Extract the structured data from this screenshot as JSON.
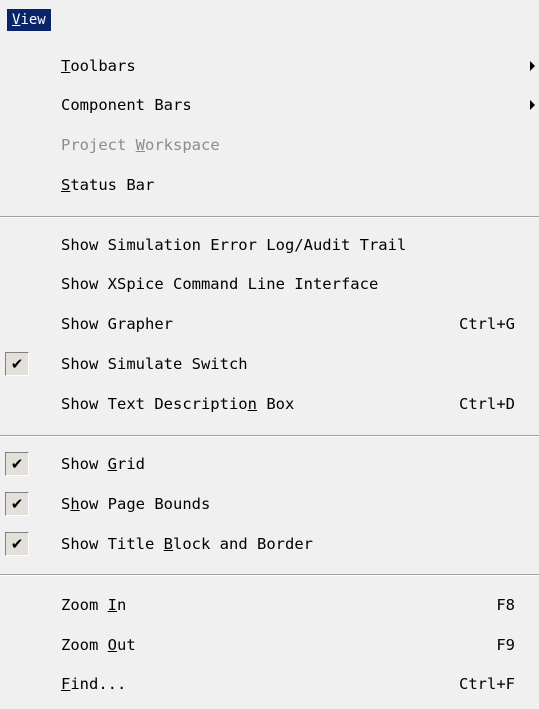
{
  "menubar": {
    "title_mnemonic": "V",
    "title_rest": "iew"
  },
  "items": {
    "toolbars": {
      "mn": "T",
      "rest": "oolbars"
    },
    "component_bars": {
      "label": "Component Bars"
    },
    "project_workspace": {
      "pre": "Project ",
      "mn": "W",
      "rest": "orkspace"
    },
    "status_bar": {
      "mn": "S",
      "rest": "tatus Bar"
    },
    "show_error_log": {
      "label": "Show Simulation Error Log/Audit Trail"
    },
    "show_xspice": {
      "label": "Show XSpice Command Line Interface"
    },
    "show_grapher": {
      "label": "Show Grapher",
      "shortcut": "Ctrl+G"
    },
    "show_simulate_switch": {
      "label": "Show Simulate Switch",
      "check": "✔"
    },
    "show_text_desc": {
      "pre": "Show Text Descriptio",
      "mn": "n",
      "rest": " Box",
      "shortcut": "Ctrl+D"
    },
    "show_grid": {
      "pre": "Show ",
      "mn": "G",
      "rest": "rid",
      "check": "✔"
    },
    "show_page_bounds": {
      "pre": "S",
      "mn": "h",
      "rest": "ow Page Bounds",
      "check": "✔"
    },
    "show_title_block": {
      "pre": "Show Title ",
      "mn": "B",
      "rest": "lock and Border",
      "check": "✔"
    },
    "zoom_in": {
      "pre": "Zoom ",
      "mn": "I",
      "rest": "n",
      "shortcut": "F8"
    },
    "zoom_out": {
      "pre": "Zoom ",
      "mn": "O",
      "rest": "ut",
      "shortcut": "F9"
    },
    "find": {
      "mn": "F",
      "rest": "ind...",
      "shortcut": "Ctrl+F"
    }
  }
}
